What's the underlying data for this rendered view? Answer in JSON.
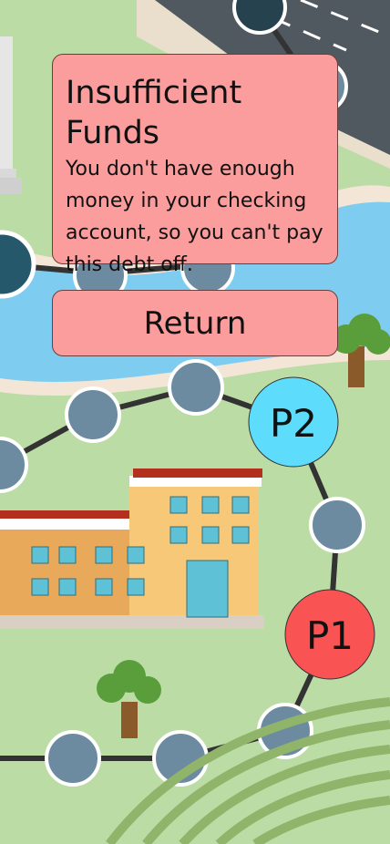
{
  "dialog": {
    "title": "Insufficient Funds",
    "message": "You don't have enough money in your checking account, so you can't pay this debt off.",
    "return_label": "Return"
  },
  "players": [
    {
      "label": "P2",
      "color": "#5ddcfb"
    },
    {
      "label": "P1",
      "color": "#f95353"
    }
  ],
  "colors": {
    "grass": "#bcdca6",
    "river": "#7ecdf0",
    "road": "#555f66",
    "space": "#6c8ba0",
    "dialog": "#fa9d9c"
  }
}
